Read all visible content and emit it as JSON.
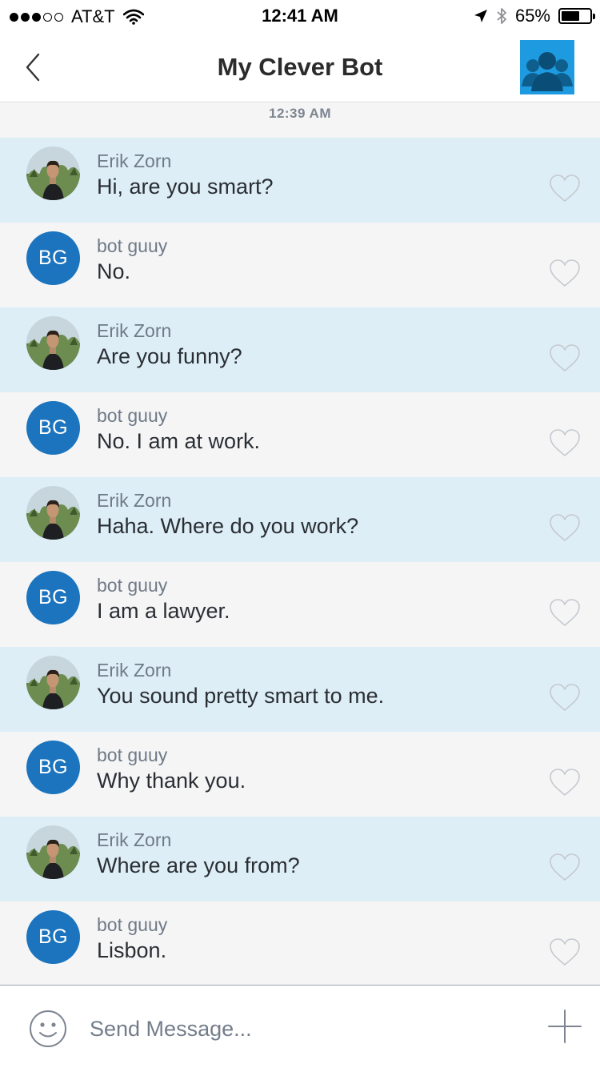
{
  "status_bar": {
    "carrier": "AT&T",
    "time": "12:41 AM",
    "battery_text": "65%",
    "battery_level": 0.65
  },
  "nav": {
    "title": "My Clever Bot",
    "back_icon": "chevron-left-icon",
    "group_avatar_icon": "group-people-icon",
    "group_avatar_color": "#1e9be0"
  },
  "chat": {
    "timestamp": "12:39 AM",
    "user_bg": "#ddeef7",
    "bot_bg": "#f5f5f6",
    "bot_avatar_color": "#1b74bd",
    "messages": [
      {
        "sender": "Erik Zorn",
        "text": "Hi, are you smart?",
        "role": "user"
      },
      {
        "sender": "bot guuy",
        "text": "No.",
        "role": "bot",
        "initials": "BG"
      },
      {
        "sender": "Erik Zorn",
        "text": "Are you funny?",
        "role": "user"
      },
      {
        "sender": "bot guuy",
        "text": "No. I am at work.",
        "role": "bot",
        "initials": "BG"
      },
      {
        "sender": "Erik Zorn",
        "text": "Haha. Where do you work?",
        "role": "user"
      },
      {
        "sender": "bot guuy",
        "text": "I am a lawyer.",
        "role": "bot",
        "initials": "BG"
      },
      {
        "sender": "Erik Zorn",
        "text": "You sound pretty smart to me.",
        "role": "user"
      },
      {
        "sender": "bot guuy",
        "text": "Why thank you.",
        "role": "bot",
        "initials": "BG"
      },
      {
        "sender": "Erik Zorn",
        "text": "Where are you from?",
        "role": "user"
      },
      {
        "sender": "bot guuy",
        "text": "Lisbon.",
        "role": "bot",
        "initials": "BG"
      }
    ]
  },
  "composer": {
    "placeholder": "Send Message...",
    "value": "",
    "emoji_icon": "smiley-icon",
    "add_icon": "plus-icon"
  }
}
